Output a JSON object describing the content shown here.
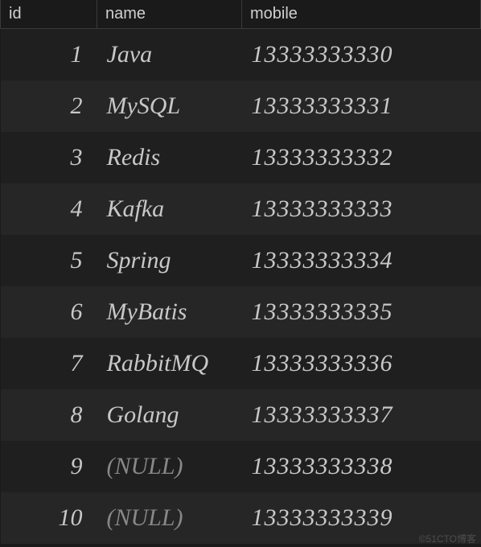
{
  "columns": {
    "id": "id",
    "name": "name",
    "mobile": "mobile"
  },
  "rows": [
    {
      "id": "1",
      "name": "Java",
      "mobile": "13333333330",
      "name_null": false
    },
    {
      "id": "2",
      "name": "MySQL",
      "mobile": "13333333331",
      "name_null": false
    },
    {
      "id": "3",
      "name": "Redis",
      "mobile": "13333333332",
      "name_null": false
    },
    {
      "id": "4",
      "name": "Kafka",
      "mobile": "13333333333",
      "name_null": false
    },
    {
      "id": "5",
      "name": "Spring",
      "mobile": "13333333334",
      "name_null": false
    },
    {
      "id": "6",
      "name": "MyBatis",
      "mobile": "13333333335",
      "name_null": false
    },
    {
      "id": "7",
      "name": "RabbitMQ",
      "mobile": "13333333336",
      "name_null": false
    },
    {
      "id": "8",
      "name": "Golang",
      "mobile": "13333333337",
      "name_null": false
    },
    {
      "id": "9",
      "name": "(NULL)",
      "mobile": "13333333338",
      "name_null": true
    },
    {
      "id": "10",
      "name": "(NULL)",
      "mobile": "13333333339",
      "name_null": true
    }
  ],
  "watermark": "©51CTO博客"
}
